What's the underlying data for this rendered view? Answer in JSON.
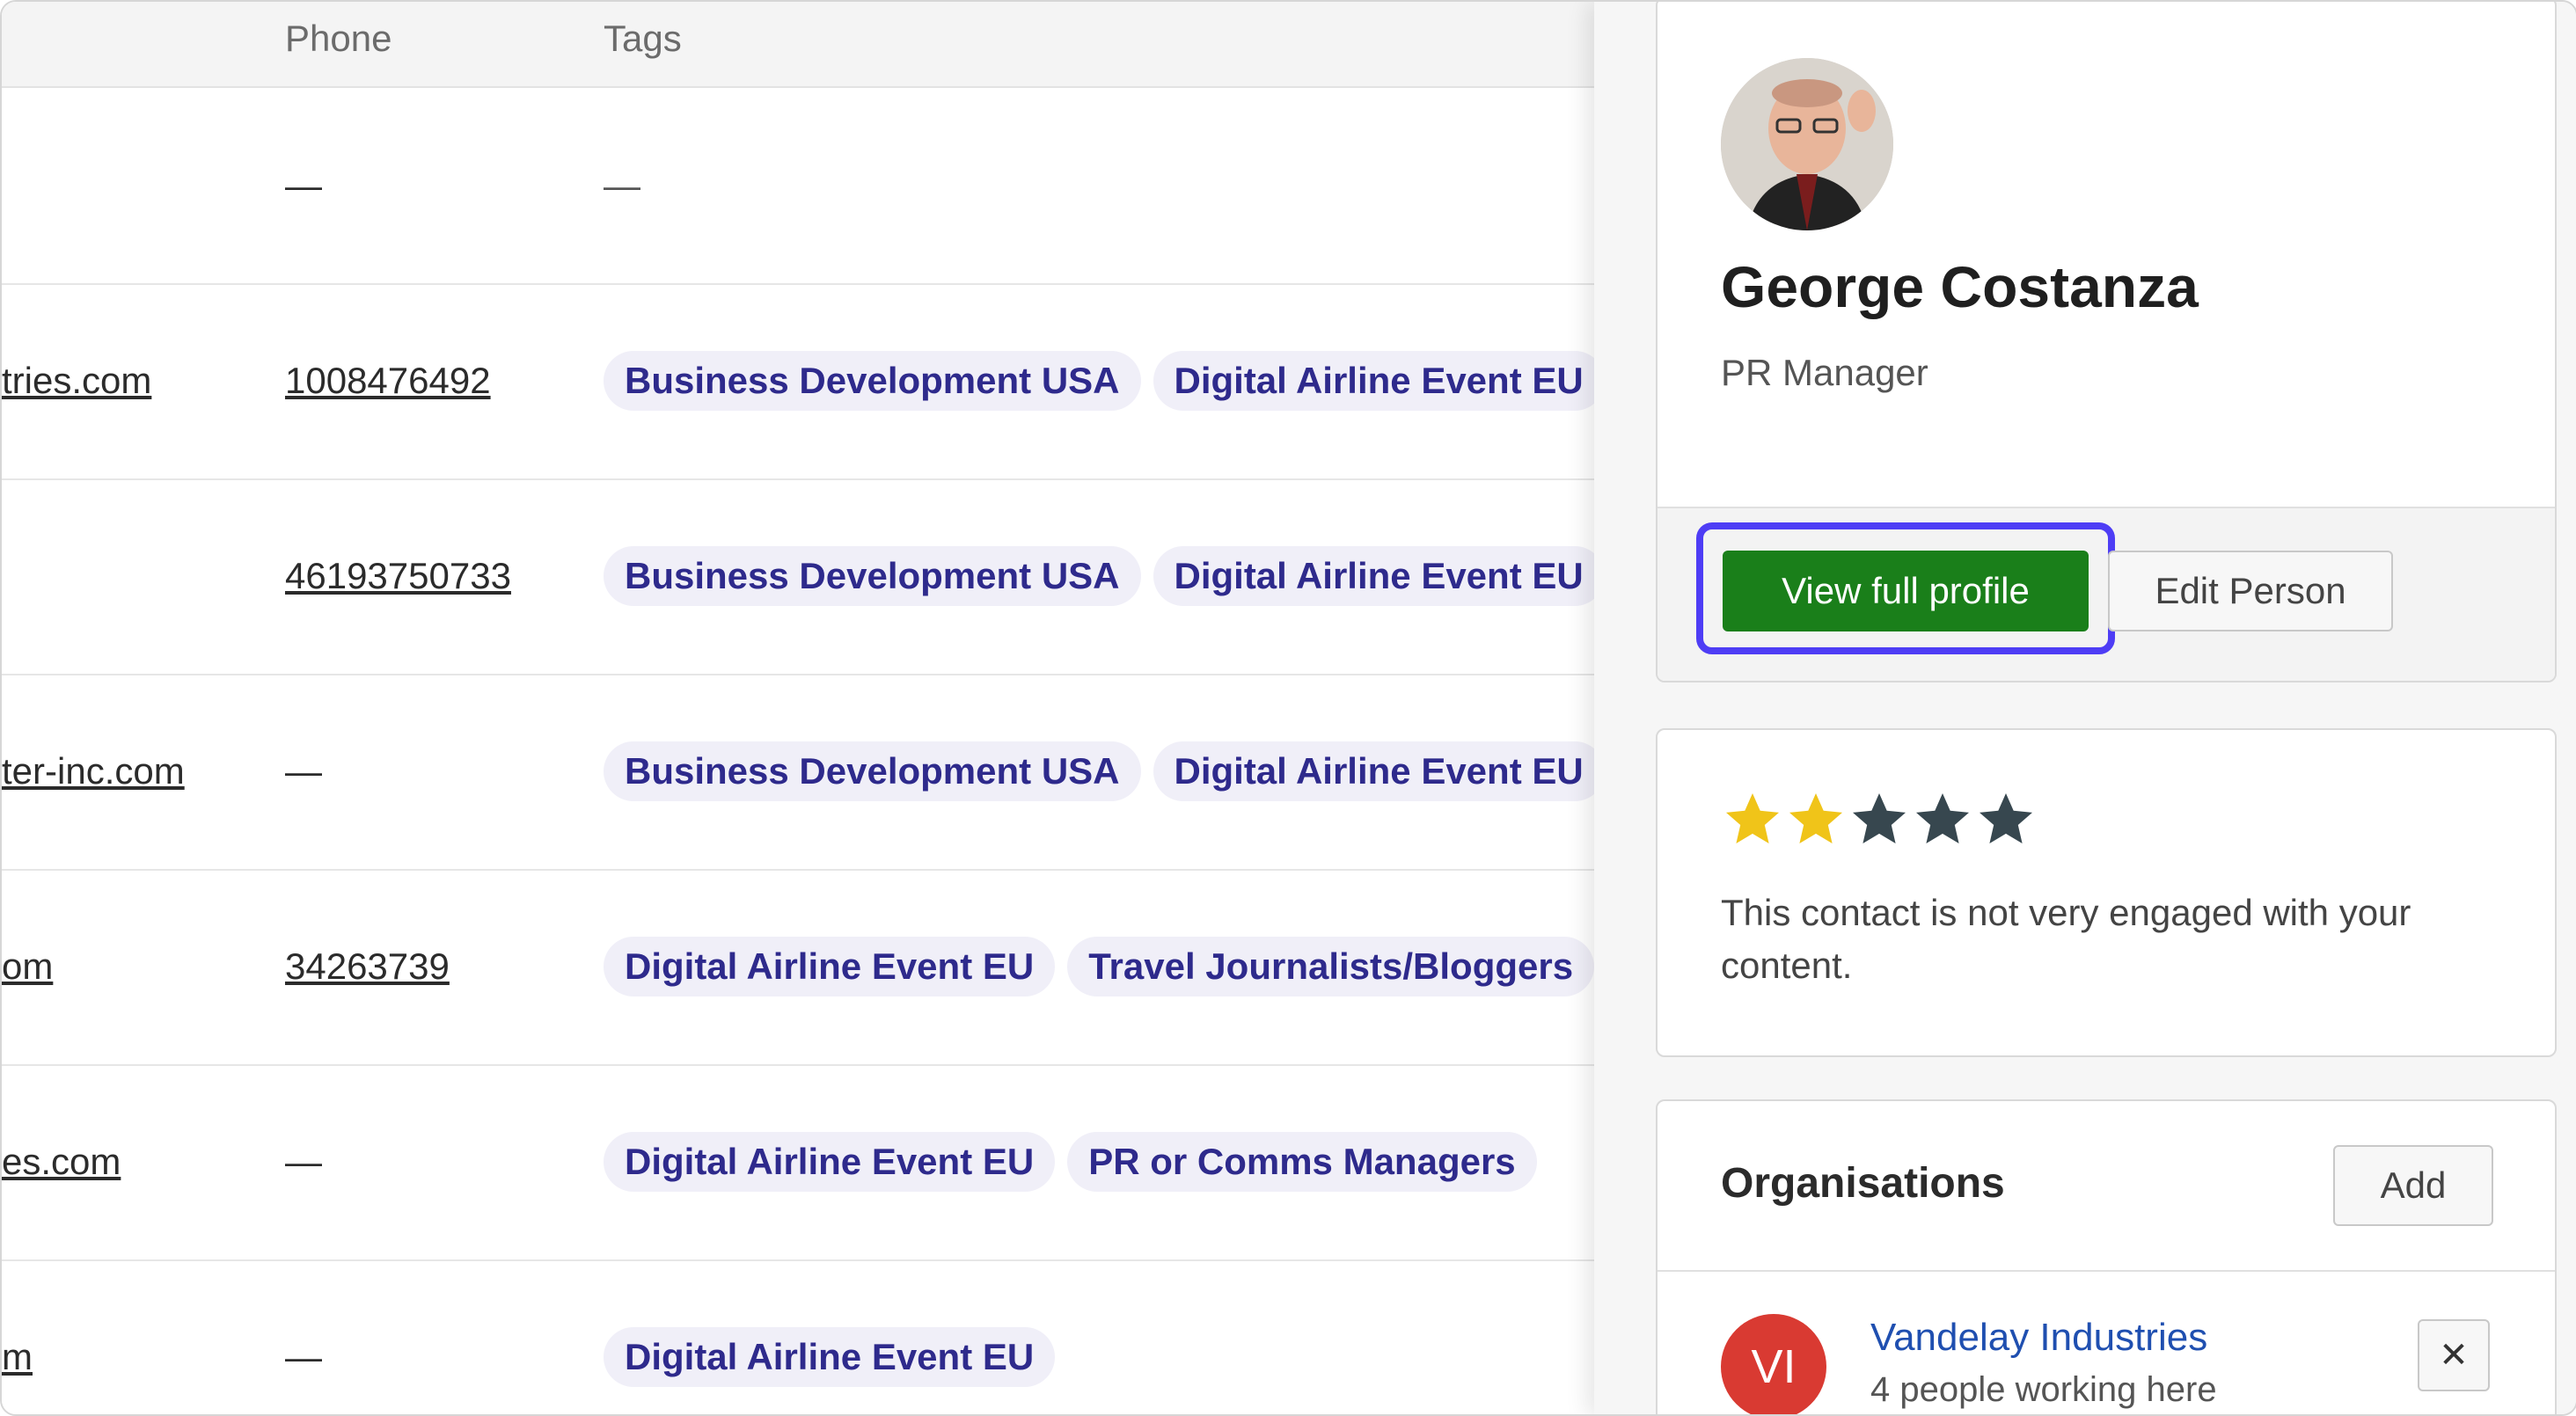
{
  "table": {
    "headers": {
      "phone": "Phone",
      "tags": "Tags"
    },
    "rows": [
      {
        "email": "",
        "phone": "—",
        "phone_is_link": false,
        "tags": [],
        "tags_empty": "—"
      },
      {
        "email": "tries.com",
        "phone": "1008476492",
        "phone_is_link": true,
        "tags": [
          "Business Development USA",
          "Digital Airline Event EU"
        ]
      },
      {
        "email": "",
        "phone": "46193750733",
        "phone_is_link": true,
        "tags": [
          "Business Development USA",
          "Digital Airline Event EU"
        ]
      },
      {
        "email": "ter-inc.com",
        "phone": "—",
        "phone_is_link": false,
        "tags": [
          "Business Development USA",
          "Digital Airline Event EU"
        ]
      },
      {
        "email": "om",
        "phone": "34263739",
        "phone_is_link": true,
        "tags": [
          "Digital Airline Event EU",
          "Travel Journalists/Bloggers"
        ]
      },
      {
        "email": "es.com",
        "phone": "—",
        "phone_is_link": false,
        "tags": [
          "Digital Airline Event EU",
          "PR or Comms Managers"
        ]
      },
      {
        "email": "m",
        "phone": "—",
        "phone_is_link": false,
        "tags": [
          "Digital Airline Event EU"
        ]
      }
    ]
  },
  "profile": {
    "name": "George Costanza",
    "role": "PR Manager",
    "view_full_profile": "View full profile",
    "edit_person": "Edit Person"
  },
  "engagement": {
    "rating": 2,
    "max_rating": 5,
    "text": "This contact is not very engaged with your content.",
    "star_on_color": "#f0c419",
    "star_off_color": "#37474f"
  },
  "organisations": {
    "title": "Organisations",
    "add_label": "Add",
    "items": [
      {
        "initials": "VI",
        "name": "Vandelay Industries",
        "subtitle": "4 people working here",
        "remove_label": "✕"
      }
    ]
  },
  "colors": {
    "primary_button": "#1a7f1a",
    "focus_ring": "#4e3df5",
    "tag_bg": "#f0eff8",
    "tag_text": "#2e2a8c",
    "link_blue": "#1f4fb0",
    "org_avatar": "#d93a32"
  }
}
